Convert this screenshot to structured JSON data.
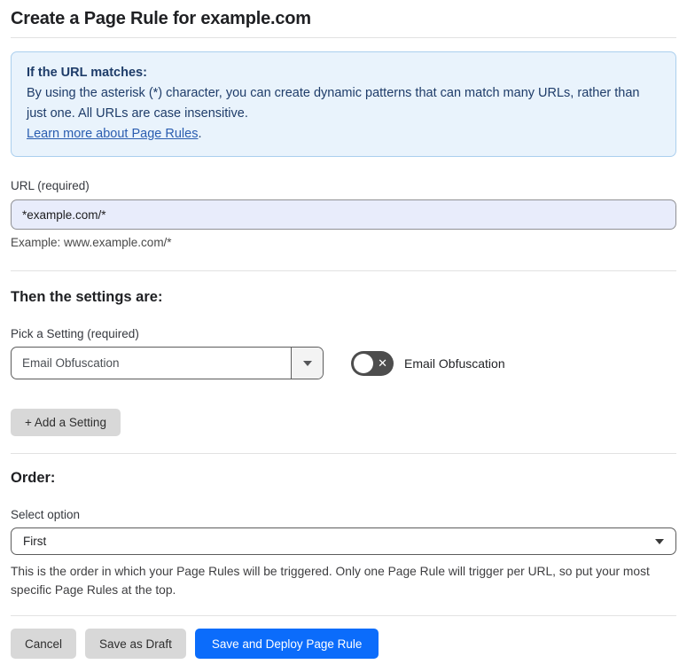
{
  "page": {
    "title": "Create a Page Rule for example.com"
  },
  "info_box": {
    "heading": "If the URL matches:",
    "body": "By using the asterisk (*) character, you can create dynamic patterns that can match many URLs, rather than just one. All URLs are case insensitive.",
    "link_label": "Learn more about Page Rules",
    "link_suffix": "."
  },
  "url_section": {
    "label": "URL (required)",
    "value": "*example.com/*",
    "example": "Example: www.example.com/*"
  },
  "settings_section": {
    "heading": "Then the settings are:",
    "picker_label": "Pick a Setting (required)",
    "picker_value": "Email Obfuscation",
    "toggle_state": "off",
    "toggle_x_glyph": "✕",
    "toggle_label": "Email Obfuscation",
    "add_button_label": "+ Add a Setting"
  },
  "order_section": {
    "heading": "Order:",
    "select_label": "Select option",
    "select_value": "First",
    "help": "This is the order in which your Page Rules will be triggered. Only one Page Rule will trigger per URL, so put your most specific Page Rules at the top."
  },
  "footer": {
    "cancel_label": "Cancel",
    "save_draft_label": "Save as Draft",
    "save_deploy_label": "Save and Deploy Page Rule"
  },
  "colors": {
    "accent_blue": "#0b6cfb",
    "info_bg": "#e9f3fc",
    "info_border": "#abcfee",
    "info_text": "#1e3c69",
    "link_blue": "#2a5db0",
    "input_autofill_bg": "#e8ecfb",
    "toggle_off_bg": "#4d4d4d",
    "button_gray": "#d8d8d8"
  }
}
